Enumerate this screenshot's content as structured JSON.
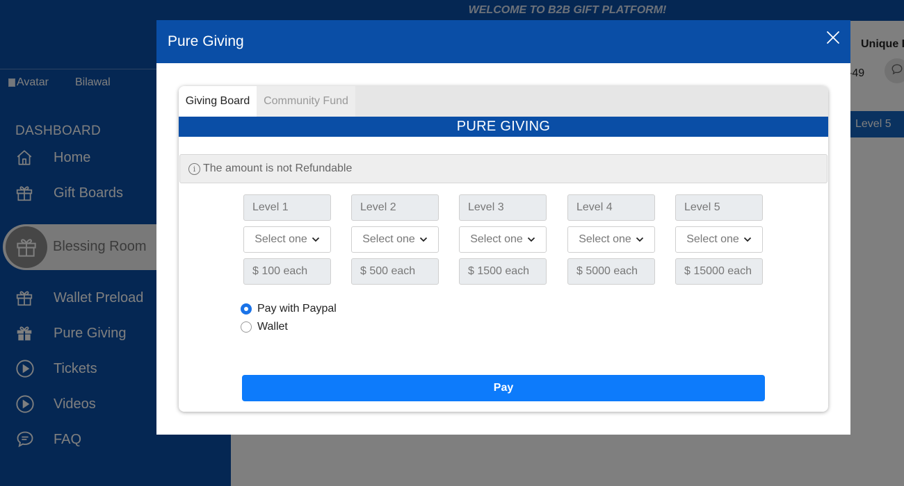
{
  "sidebar": {
    "avatar_alt": "Avatar",
    "username": "Bilawal",
    "section_title": "DASHBOARD",
    "items": [
      {
        "label": "Home",
        "icon": "home-icon"
      },
      {
        "label": "Gift Boards",
        "icon": "gift-icon"
      },
      {
        "label": "Blessing Room",
        "icon": "gift-icon",
        "active": true
      },
      {
        "label": "Wallet Preload",
        "icon": "gift-icon"
      },
      {
        "label": "Pure Giving",
        "icon": "gift-filled-icon"
      },
      {
        "label": "Tickets",
        "icon": "play-circle-icon"
      },
      {
        "label": "Videos",
        "icon": "play-circle-icon"
      },
      {
        "label": "FAQ",
        "icon": "chat-icon"
      }
    ]
  },
  "header": {
    "welcome": "WELCOME TO B2B GIFT PLATFORM!",
    "unique_label": "Unique I",
    "code_fragment": "-49",
    "level_tab": "Level 5"
  },
  "modal": {
    "title": "Pure Giving",
    "tabs": [
      {
        "label": "Giving Board",
        "active": true
      },
      {
        "label": "Community Fund",
        "active": false
      }
    ],
    "banner": "PURE GIVING",
    "alert": "The amount is not Refundable",
    "levels": [
      {
        "label": "Level 1",
        "select": "Select one",
        "price": "$ 100 each"
      },
      {
        "label": "Level 2",
        "select": "Select one",
        "price": "$ 500 each"
      },
      {
        "label": "Level 3",
        "select": "Select one",
        "price": "$ 1500 each"
      },
      {
        "label": "Level 4",
        "select": "Select one",
        "price": "$ 5000 each"
      },
      {
        "label": "Level 5",
        "select": "Select one",
        "price": "$ 15000 each"
      }
    ],
    "payment_options": [
      {
        "label": "Pay with Paypal",
        "checked": true
      },
      {
        "label": "Wallet",
        "checked": false
      }
    ],
    "pay_button": "Pay"
  },
  "colors": {
    "brand": "#0a4ea6",
    "primary_button": "#0d7bfb",
    "radio_checked": "#1a73e8"
  }
}
